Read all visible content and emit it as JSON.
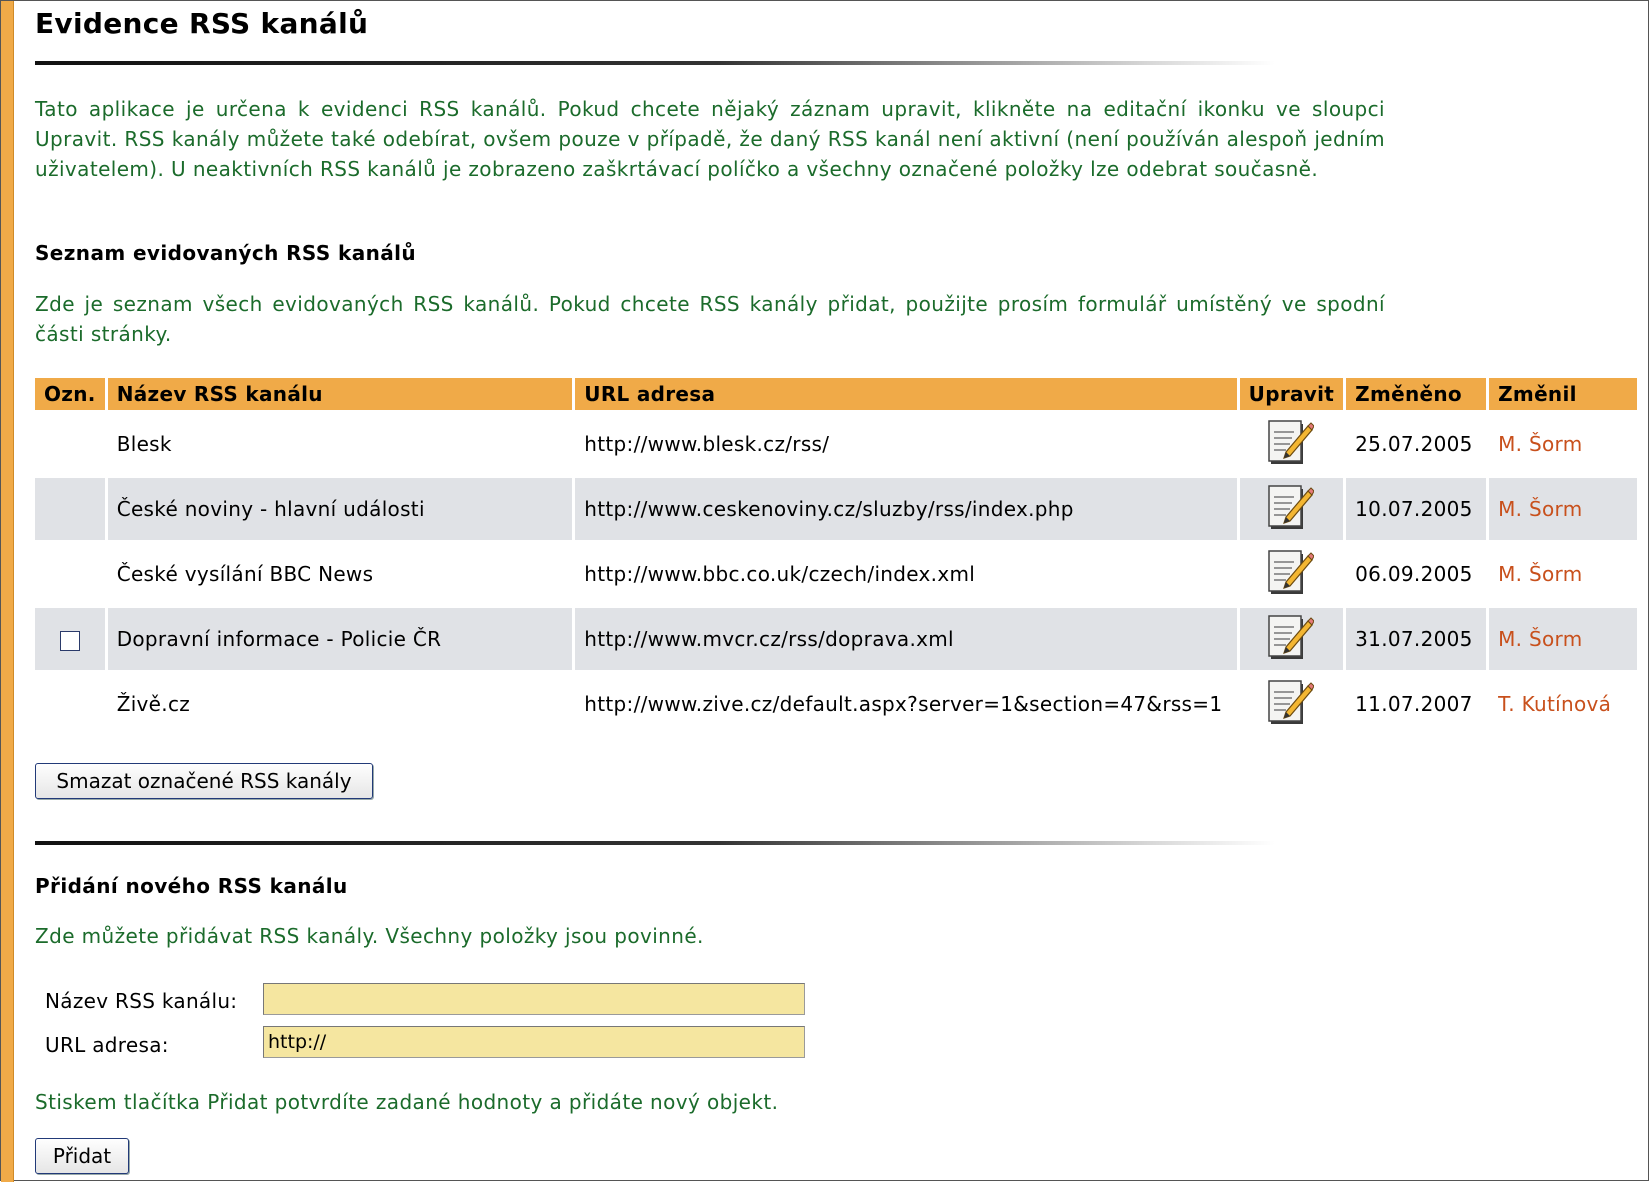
{
  "page": {
    "title": "Evidence RSS kanálů",
    "intro": "Tato aplikace je určena k evidenci RSS kanálů. Pokud chcete nějaký záznam upravit, klikněte na editační ikonku ve sloupci Upravit. RSS kanály můžete také odebírat, ovšem pouze v případě, že daný RSS kanál není aktivní (není používán alespoň jedním uživatelem). U neaktivních RSS kanálů je zobrazeno zaškrtávací políčko a všechny označené položky lze odebrat současně."
  },
  "list": {
    "heading": "Seznam evidovaných RSS kanálů",
    "description": "Zde je seznam všech evidovaných RSS kanálů. Pokud chcete RSS kanály přidat, použijte prosím formulář umístěný ve spodní části stránky.",
    "columns": [
      "Ozn.",
      "Název RSS kanálu",
      "URL adresa",
      "Upravit",
      "Změněno",
      "Změnil"
    ],
    "rows": [
      {
        "checkbox": false,
        "name": "Blesk",
        "url": "http://www.blesk.cz/rss/",
        "changed": "25.07.2005",
        "by": "M. Šorm"
      },
      {
        "checkbox": false,
        "name": "České noviny - hlavní události",
        "url": "http://www.ceskenoviny.cz/sluzby/rss/index.php",
        "changed": "10.07.2005",
        "by": "M. Šorm"
      },
      {
        "checkbox": false,
        "name": "České vysílání BBC News",
        "url": "http://www.bbc.co.uk/czech/index.xml",
        "changed": "06.09.2005",
        "by": "M. Šorm"
      },
      {
        "checkbox": true,
        "name": "Dopravní informace - Policie ČR",
        "url": "http://www.mvcr.cz/rss/doprava.xml",
        "changed": "31.07.2005",
        "by": "M. Šorm"
      },
      {
        "checkbox": false,
        "name": "Živě.cz",
        "url": "http://www.zive.cz/default.aspx?server=1&section=47&rss=1",
        "changed": "11.07.2007",
        "by": "T. Kutínová"
      }
    ],
    "delete_button": "Smazat označené RSS kanály"
  },
  "add": {
    "heading": "Přidání nového RSS kanálu",
    "description": "Zde můžete přidávat RSS kanály. Všechny položky jsou povinné.",
    "name_label": "Název RSS kanálu:",
    "name_value": "",
    "url_label": "URL adresa:",
    "url_value": "http://",
    "confirm_text": "Stiskem tlačítka Přidat potvrdíte zadané hodnoty a přidáte nový objekt.",
    "add_button": "Přidat"
  },
  "colors": {
    "accent": "#f0aa48",
    "text_green": "#1b6b2b",
    "author": "#c8501c",
    "row_alt": "#e0e2e6",
    "input_bg": "#f5e6a0"
  },
  "icons": {
    "edit": "edit-document-pencil-icon"
  }
}
